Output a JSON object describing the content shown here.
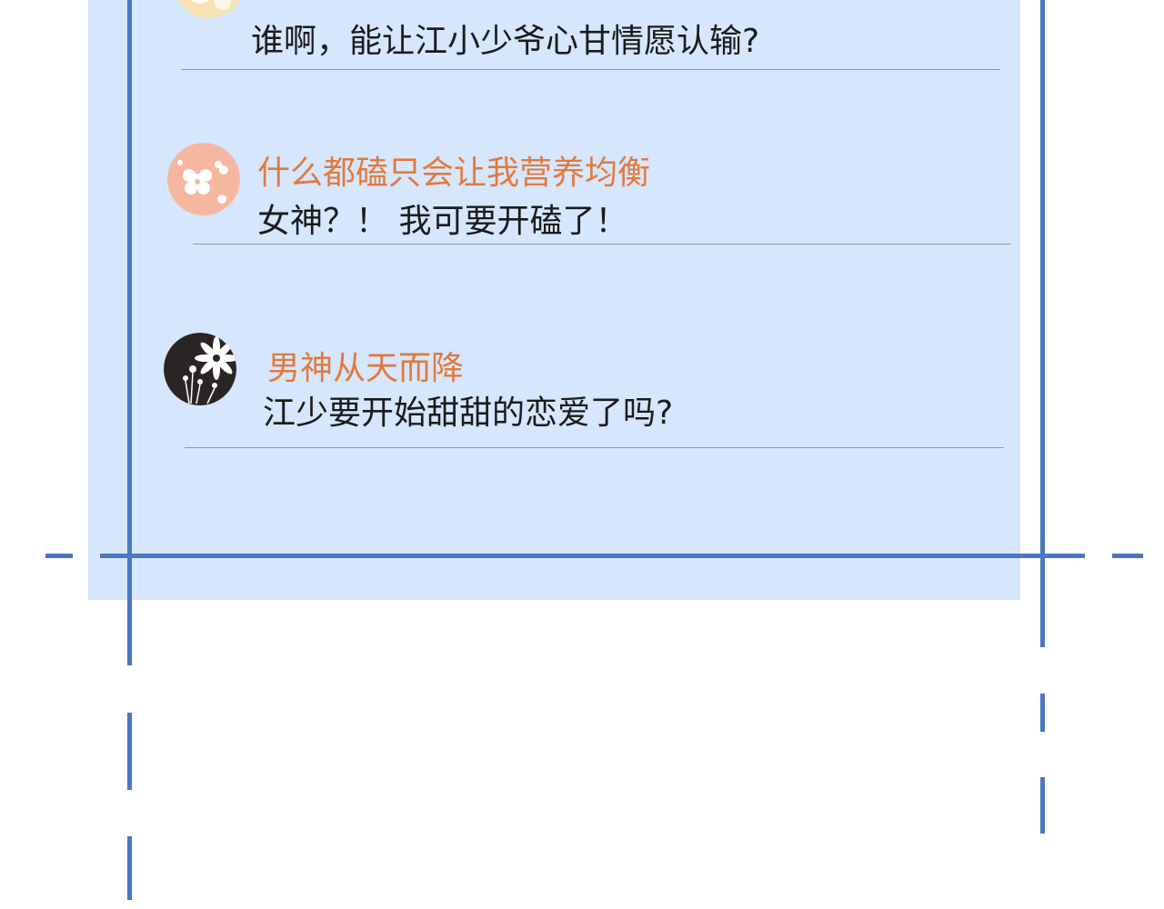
{
  "comments": [
    {
      "username": "",
      "text": "谁啊，能让江小少爷心甘情愿认输?",
      "avatar": "yellow-flower-avatar"
    },
    {
      "username": "什么都磕只会让我营养均衡",
      "text": "女神？！ 我可要开磕了！",
      "avatar": "pink-flower-avatar"
    },
    {
      "username": "男神从天而降",
      "text": "江少要开始甜甜的恋爱了吗?",
      "avatar": "dark-flower-avatar"
    }
  ],
  "colors": {
    "panel": "#d6e6fc",
    "frame_line": "#4a78c0",
    "username": "#e07a3e",
    "text": "#1b1b1b"
  }
}
